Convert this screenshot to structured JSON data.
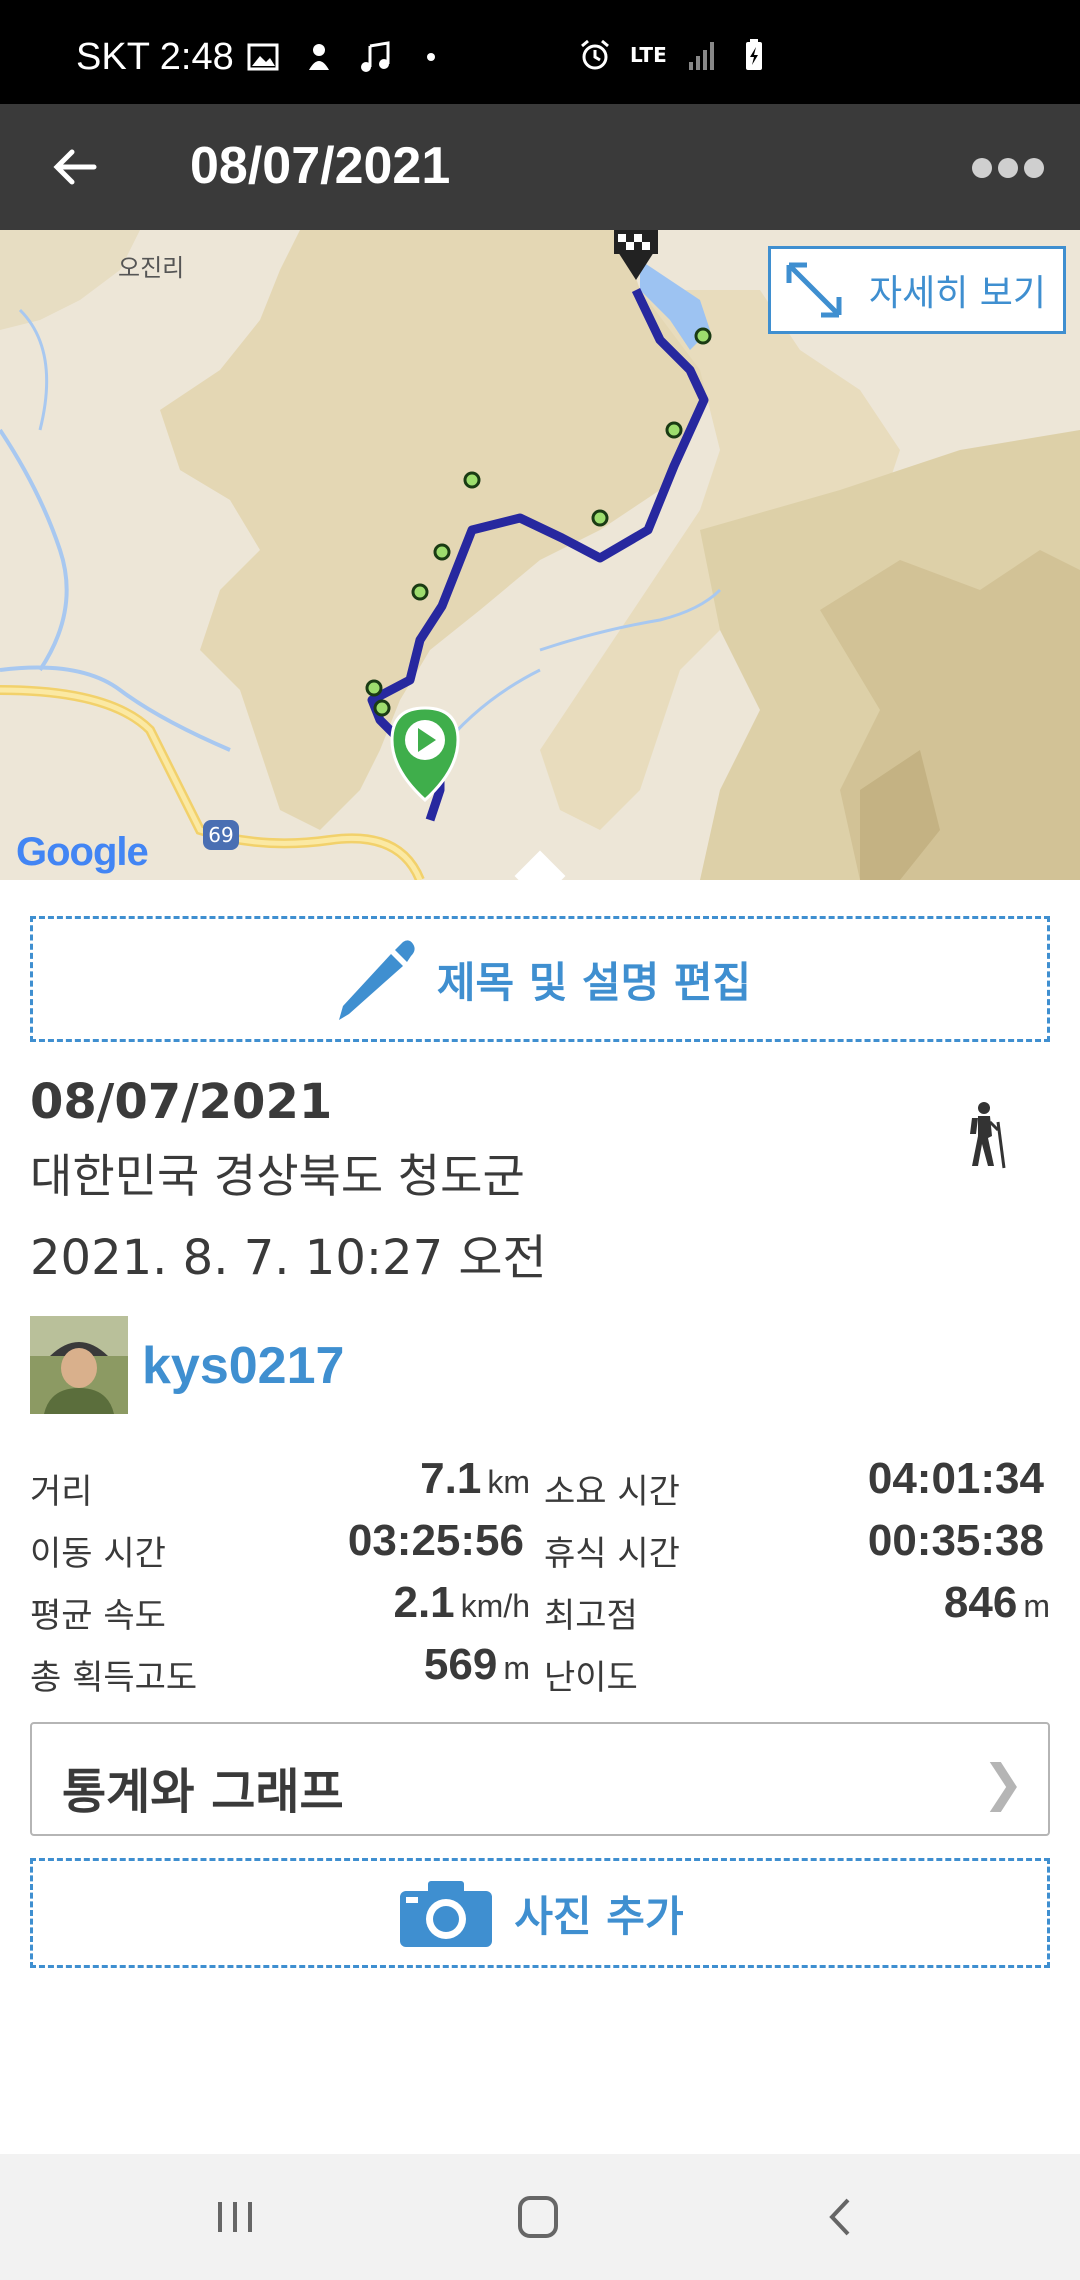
{
  "status_bar": {
    "time": "SKT 2:48",
    "network": "LTE"
  },
  "app_bar": {
    "title": "08/07/2021"
  },
  "map": {
    "place_label": "오진리",
    "detail_button": "자세히 보기",
    "attribution": "Google",
    "road_number": "69",
    "route_color": "#27289f",
    "waypoint_color": "#9ddd6e"
  },
  "edit_button": "제목 및 설명 편집",
  "info": {
    "date": "08/07/2021",
    "location": "대한민국 경상북도 청도군",
    "datetime": "2021. 8. 7. 10:27 오전",
    "activity_icon": "hiker-icon"
  },
  "user": {
    "name": "kys0217"
  },
  "stats": [
    {
      "label": "거리",
      "value": "7.1",
      "unit": "km",
      "label2": "소요 시간",
      "value2": "04:01:34",
      "unit2": ""
    },
    {
      "label": "이동 시간",
      "value": "03:25:56",
      "unit": "",
      "label2": "휴식 시간",
      "value2": "00:35:38",
      "unit2": ""
    },
    {
      "label": "평균 속도",
      "value": "2.1",
      "unit": "km/h",
      "label2": "최고점",
      "value2": "846",
      "unit2": "m"
    },
    {
      "label": "총 획득고도",
      "value": "569",
      "unit": "m",
      "label2": "난이도",
      "value2": "",
      "unit2": ""
    }
  ],
  "graph_button": "통계와 그래프",
  "photo_button": "사진 추가",
  "colors": {
    "accent": "#3f8fd0",
    "app_bar": "#3a3a3a"
  }
}
